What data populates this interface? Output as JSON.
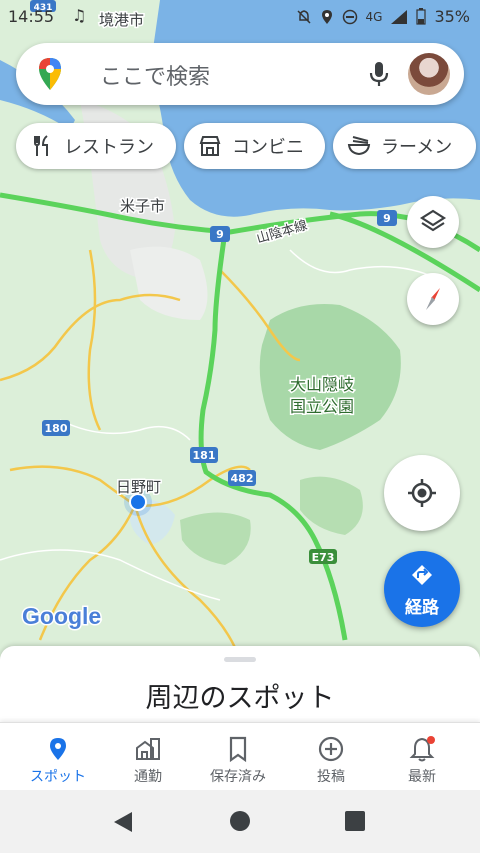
{
  "status_bar": {
    "time": "14:55",
    "network": "4G",
    "battery": "35%"
  },
  "search": {
    "placeholder": "ここで検索"
  },
  "chips": [
    {
      "label": "レストラン",
      "icon": "restaurant-icon"
    },
    {
      "label": "コンビニ",
      "icon": "convenience-store-icon"
    },
    {
      "label": "ラーメン",
      "icon": "ramen-icon"
    }
  ],
  "map": {
    "labels": {
      "sakaiminato": "境港市",
      "yonago": "米子市",
      "sanin_line": "山陰本線",
      "daisen_park_line1": "大山隠岐",
      "daisen_park_line2": "国立公園",
      "hino": "日野町",
      "google": "Google"
    },
    "route_shields": {
      "r9_left": "9",
      "r9_right": "9",
      "r180": "180",
      "r181": "181",
      "r482": "482",
      "e73": "E73",
      "r431": "431"
    },
    "colors": {
      "land": "#dff0dc",
      "park": "#a8d8a8",
      "water": "#7bb3e6",
      "highway": "#5bd35b",
      "route": "#f3c74b",
      "accent": "#1a73e8"
    }
  },
  "route_button": {
    "label": "経路"
  },
  "sheet": {
    "title": "周辺のスポット"
  },
  "bottom_nav": [
    {
      "label": "スポット",
      "icon": "place-pin-icon",
      "active": true
    },
    {
      "label": "通勤",
      "icon": "commute-icon",
      "active": false
    },
    {
      "label": "保存済み",
      "icon": "bookmark-icon",
      "active": false
    },
    {
      "label": "投稿",
      "icon": "add-circle-icon",
      "active": false
    },
    {
      "label": "最新",
      "icon": "bell-icon",
      "active": false
    }
  ]
}
